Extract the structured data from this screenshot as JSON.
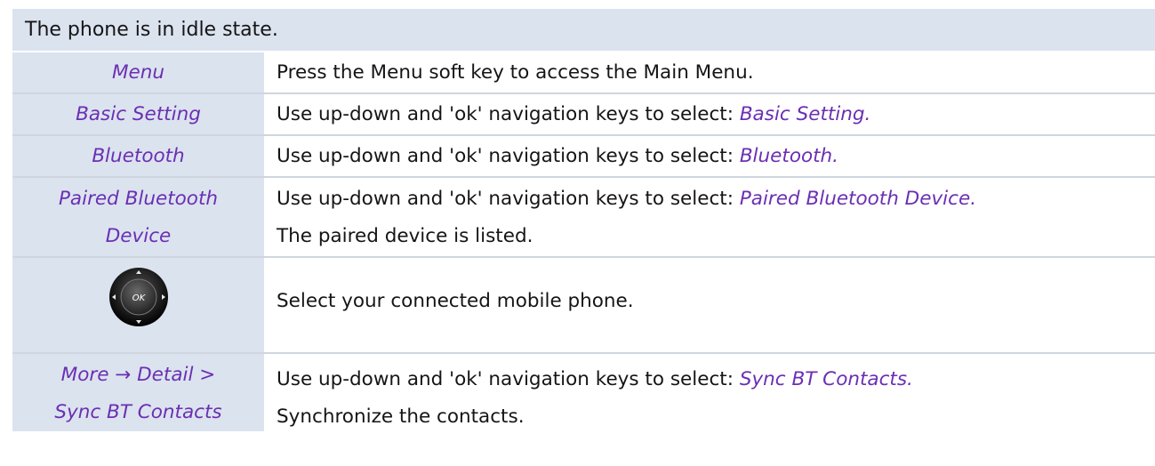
{
  "header": {
    "text": "The phone is in idle state."
  },
  "rows": [
    {
      "left": "Menu",
      "right": "Press the Menu soft key to access the Main Menu."
    },
    {
      "left": "Basic Setting",
      "prefix": "Use up-down and 'ok' navigation keys to select: ",
      "highlight": "Basic Setting."
    },
    {
      "left": "Bluetooth",
      "prefix": "Use up-down and 'ok' navigation keys to select: ",
      "highlight": "Bluetooth."
    },
    {
      "left_line1": "Paired Bluetooth",
      "left_line2": "Device",
      "prefix": "Use up-down and 'ok' navigation keys to select: ",
      "highlight": "Paired Bluetooth Device.",
      "line2": "The paired device is listed."
    },
    {
      "icon": "ok-navigation-key-icon",
      "icon_label": "OK",
      "right": "Select your connected mobile phone."
    },
    {
      "left_line1": "More → Detail >",
      "left_line2": "Sync BT Contacts",
      "prefix": "Use up-down and 'ok' navigation keys to select: ",
      "highlight": "Sync BT Contacts.",
      "line2": "Synchronize the contacts."
    }
  ],
  "colors": {
    "left_column_bg": "#dbe3ef",
    "highlight_text": "#6b2fb3"
  }
}
